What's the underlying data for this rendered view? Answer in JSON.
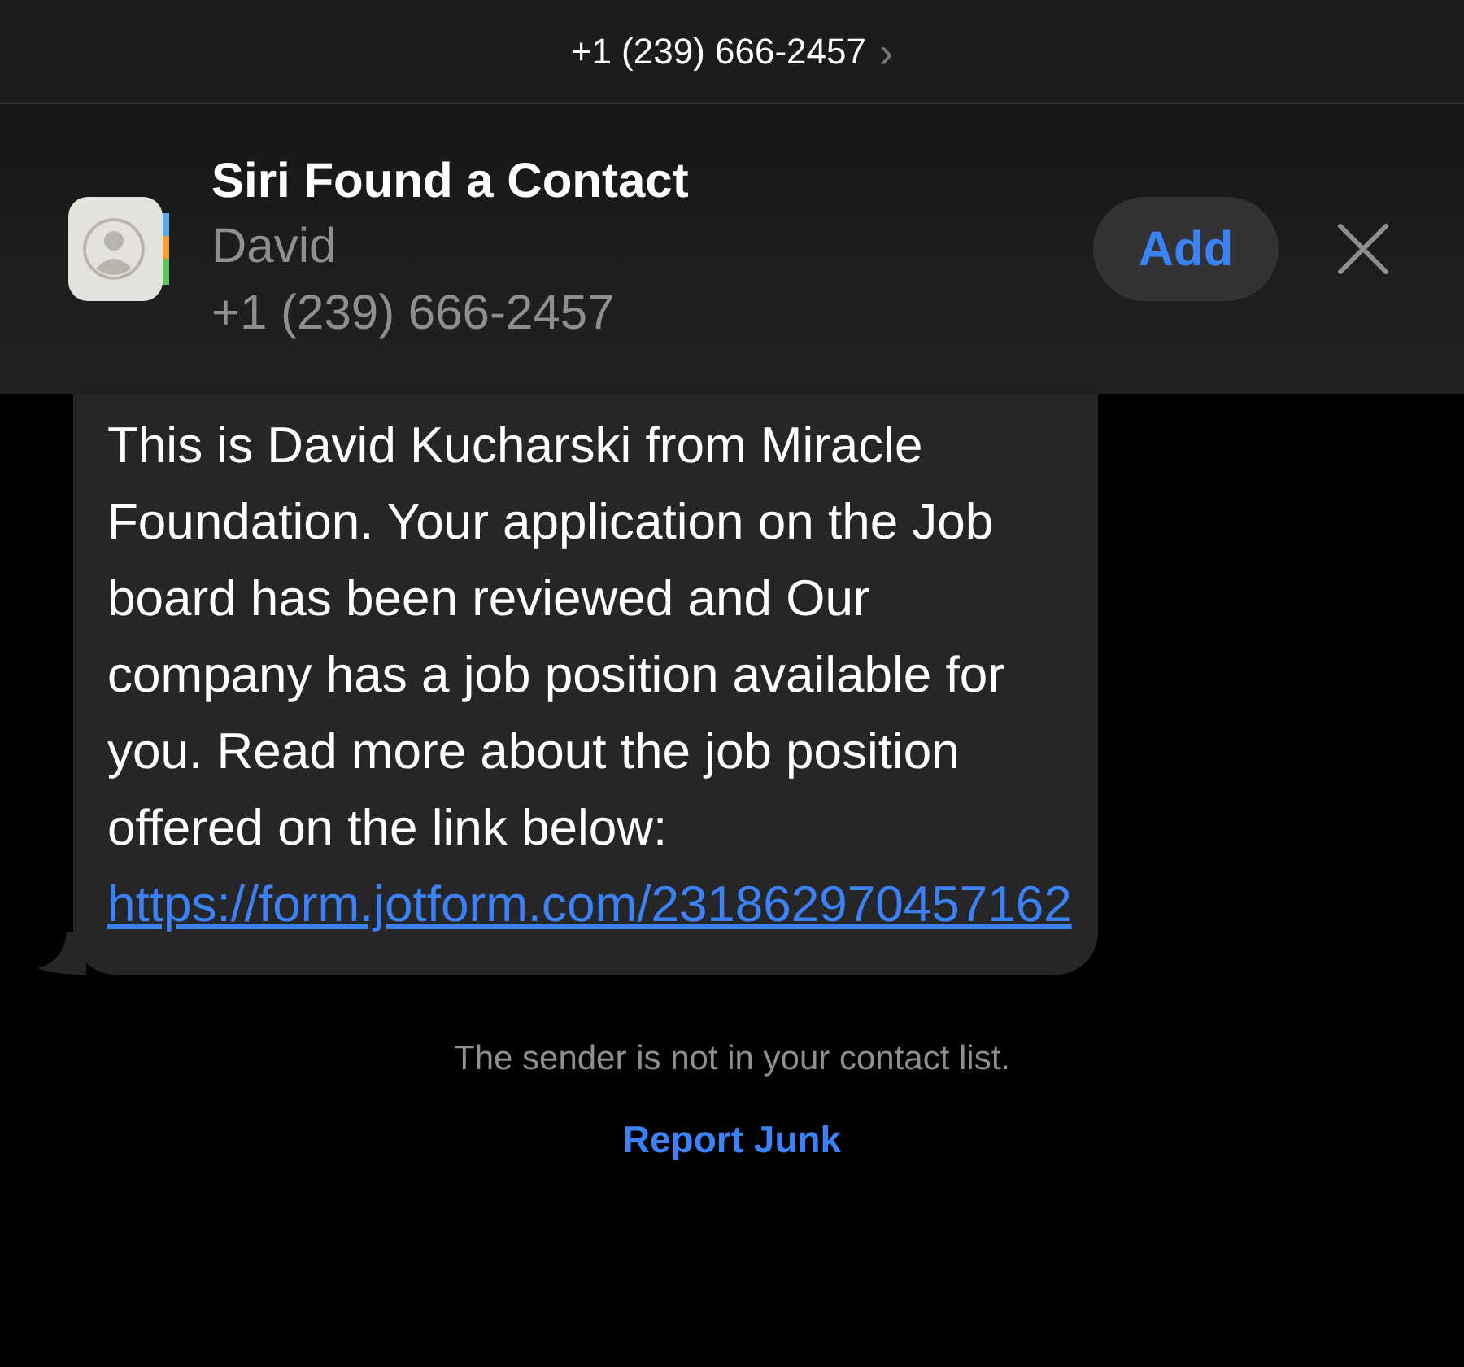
{
  "header": {
    "phone": "+1 (239) 666-2457",
    "chevron": "›"
  },
  "banner": {
    "title": "Siri Found a Contact",
    "name": "David",
    "phone": "+1 (239) 666-2457",
    "add_button": "Add"
  },
  "message": {
    "text": "This is David Kucharski from Miracle Foundation. Your application on the Job board has been reviewed and Our company has a job position available for you. Read more about the job position offered on the link below: ",
    "link": "https://form.jotform.com/231862970457162"
  },
  "footer": {
    "notice": "The sender is not in your contact list.",
    "report_link": "Report Junk"
  }
}
